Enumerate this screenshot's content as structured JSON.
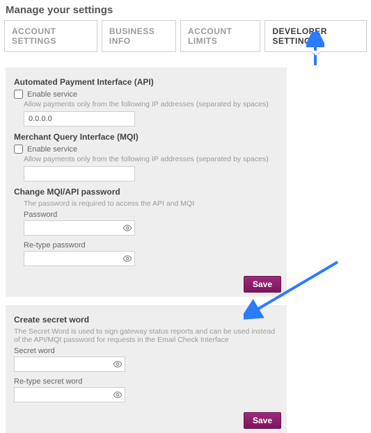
{
  "page_title": "Manage your settings",
  "tabs": [
    {
      "label": "ACCOUNT SETTINGS",
      "active": false
    },
    {
      "label": "BUSINESS INFO",
      "active": false
    },
    {
      "label": "ACCOUNT LIMITS",
      "active": false
    },
    {
      "label": "DEVELOPER SETTINGS",
      "active": true
    }
  ],
  "panel1": {
    "api": {
      "title": "Automated Payment Interface (API)",
      "enable_label": "Enable service",
      "enable_checked": false,
      "ip_hint": "Allow payments only from the following IP addresses (separated by spaces)",
      "ip_value": "0.0.0.0"
    },
    "mqi": {
      "title": "Merchant Query Interface (MQI)",
      "enable_label": "Enable service",
      "enable_checked": false,
      "ip_hint": "Allow payments only from the following IP addresses (separated by spaces)",
      "ip_value": ""
    },
    "pwd": {
      "title": "Change MQI/API password",
      "hint": "The password is required to access the API and MQI",
      "password_label": "Password",
      "retype_label": "Re-type password"
    },
    "save_label": "Save"
  },
  "panel2": {
    "title": "Create secret word",
    "hint": "The Secret Word is used to sign gateway status reports and can be used instead of the API/MQI password for requests in the Email Check Interface",
    "secret_label": "Secret word",
    "retype_label": "Re-type secret word",
    "save_label": "Save"
  }
}
